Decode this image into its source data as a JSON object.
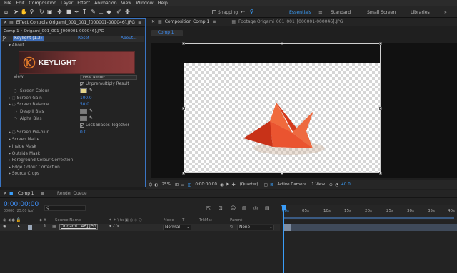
{
  "menu": [
    "File",
    "Edit",
    "Composition",
    "Layer",
    "Effect",
    "Animation",
    "View",
    "Window",
    "Help"
  ],
  "toolbar": {
    "snapping_label": "Snapping",
    "workspaces": [
      "Essentials",
      "Standard",
      "Small Screen",
      "Libraries"
    ],
    "active_workspace": "Essentials"
  },
  "effect_controls": {
    "tab_label": "Effect Controls Origami_001_001_[000001-000046].JPG",
    "breadcrumb": "Comp 1 • Origami_001_001_[000001-000046].JPG",
    "effect_name": "Keylight (1.2)",
    "reset_label": "Reset",
    "about_label": "About...",
    "about_section": "About",
    "banner_text": "KEYLIGHT",
    "view_label": "View",
    "view_value": "Final Result",
    "unpremultiply_label": "Unpremultiply Result",
    "screen_colour_label": "Screen Colour",
    "screen_gain_label": "Screen Gain",
    "screen_gain_value": "100.0",
    "screen_balance_label": "Screen Balance",
    "screen_balance_value": "50.0",
    "despill_bias_label": "Despill Bias",
    "alpha_bias_label": "Alpha Bias",
    "lock_biases_label": "Lock Biases Together",
    "screen_preblur_label": "Screen Pre-blur",
    "screen_preblur_value": "0.0",
    "groups": [
      "Screen Matte",
      "Inside Mask",
      "Outside Mask",
      "Foreground Colour Correction",
      "Edge Colour Correction",
      "Source Crops"
    ],
    "screen_colour_hex": "#e6d68a"
  },
  "composition": {
    "tab_label": "Composition Comp 1",
    "footage_tab_label": "Footage Origami_001_001_[000001-000046].JPG",
    "subtab_label": "Comp 1",
    "zoom": "25%",
    "timecode": "0:00:00:00",
    "resolution": "(Quarter)",
    "camera": "Active Camera",
    "views": "1 View",
    "exposure": "+0.0"
  },
  "timeline": {
    "comp_tab": "Comp 1",
    "render_queue_tab": "Render Queue",
    "timecode": "0:00:00:00",
    "fps": "00000 (25.00 fps)",
    "search_placeholder": "",
    "columns": {
      "source_name": "Source Name",
      "mode": "Mode",
      "trkmat": "TrkMat",
      "parent": "Parent"
    },
    "ruler_ticks": [
      "00s",
      "05s",
      "10s",
      "15s",
      "20s",
      "25s",
      "30s",
      "35s",
      "40s"
    ],
    "layers": [
      {
        "index": "1",
        "name": "Origami...46].JPG",
        "mode": "Normal",
        "parent": "None"
      }
    ]
  }
}
